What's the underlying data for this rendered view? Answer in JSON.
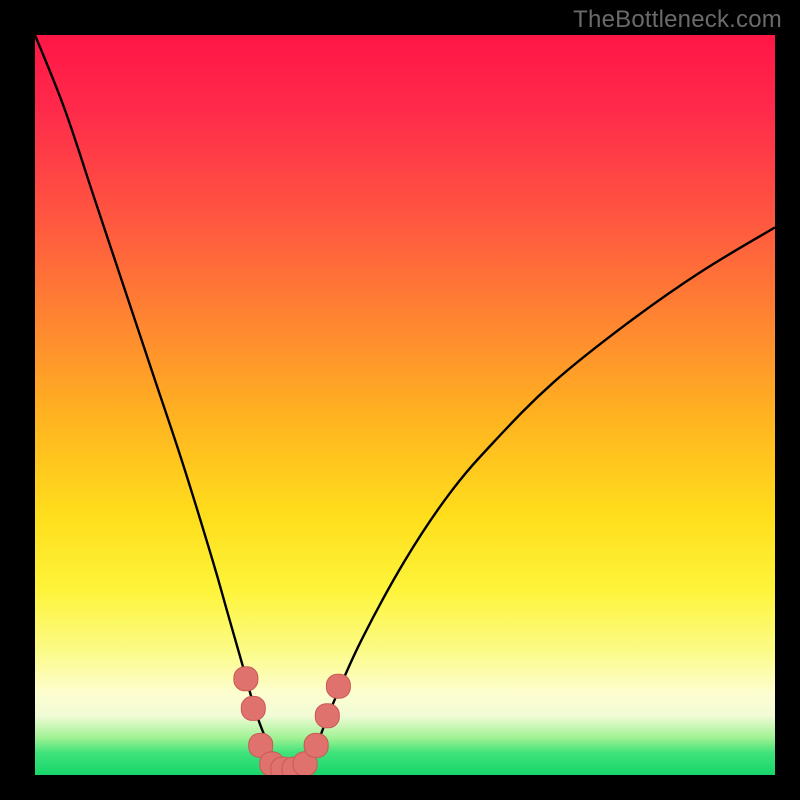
{
  "watermark": {
    "text": "TheBottleneck.com"
  },
  "colors": {
    "curve": "#000000",
    "marker_fill": "#e0726e",
    "marker_stroke": "#c95955",
    "green": "#18d66b"
  },
  "chart_data": {
    "type": "line",
    "title": "",
    "xlabel": "",
    "ylabel": "",
    "xlim": [
      0,
      100
    ],
    "ylim": [
      0,
      100
    ],
    "series": [
      {
        "name": "bottleneck-curve",
        "x": [
          0,
          4,
          8,
          12,
          16,
          20,
          24,
          26,
          28,
          30,
          32,
          33,
          34,
          35,
          36,
          38,
          40,
          44,
          50,
          56,
          62,
          70,
          80,
          90,
          100
        ],
        "values": [
          100,
          90,
          78,
          66,
          54,
          42,
          29,
          22,
          15,
          8,
          3,
          1,
          0,
          0,
          1,
          4,
          9,
          18,
          29,
          38,
          45,
          53,
          61,
          68,
          74
        ]
      }
    ],
    "markers": {
      "name": "highlighted-points",
      "shape": "rounded-square",
      "points": [
        {
          "x": 28.5,
          "y": 13
        },
        {
          "x": 29.5,
          "y": 9
        },
        {
          "x": 30.5,
          "y": 4
        },
        {
          "x": 32.0,
          "y": 1.5
        },
        {
          "x": 33.5,
          "y": 0.8
        },
        {
          "x": 35.0,
          "y": 0.8
        },
        {
          "x": 36.5,
          "y": 1.5
        },
        {
          "x": 38.0,
          "y": 4
        },
        {
          "x": 39.5,
          "y": 8
        },
        {
          "x": 41.0,
          "y": 12
        }
      ]
    }
  }
}
